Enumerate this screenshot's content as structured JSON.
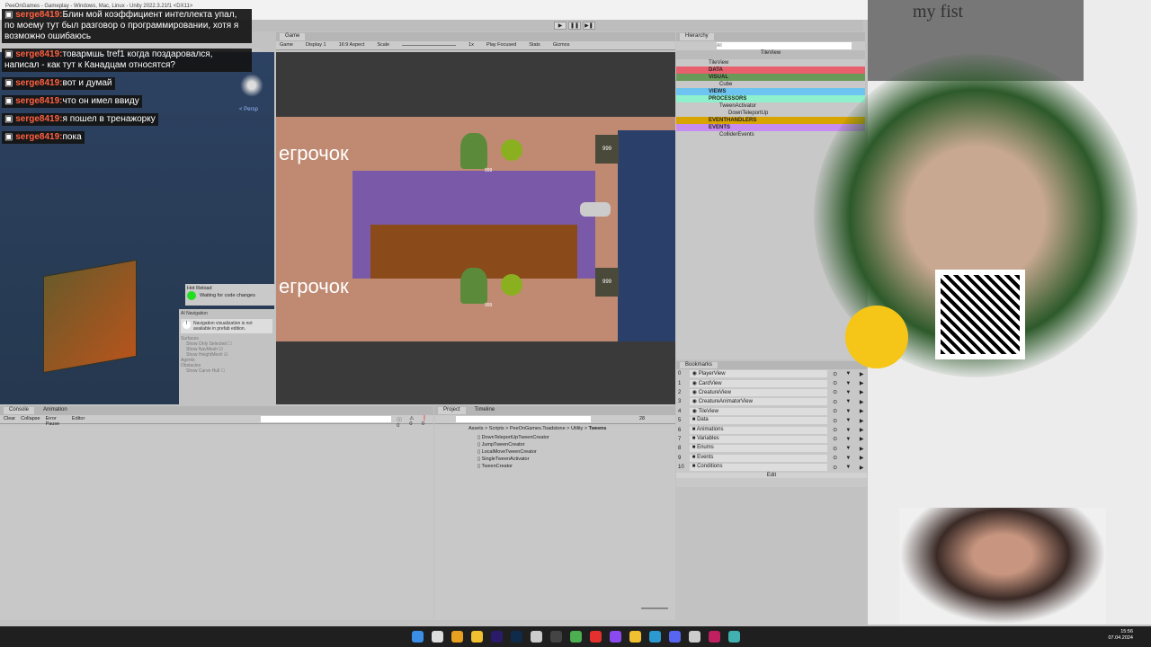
{
  "window": {
    "title": "PeeOnGames - Gameplay - Windows, Mac, Linux - Unity 2022.3.21f1 <DX11>"
  },
  "play_controls": [
    "▶",
    "❚❚",
    "▶❚"
  ],
  "chat": [
    {
      "user": "serge8419:",
      "text": "Блин мой коэффициент интеллекта упал, по моему тут был разговор о программировании, хотя я возможно ошибаюсь"
    },
    {
      "user": "serge8419:",
      "text": "товармшь tref1 когда поздаровался, написал - как тут к Канадцам относятся?"
    },
    {
      "user": "serge8419:",
      "text": "вот и думай"
    },
    {
      "user": "serge8419:",
      "text": "что он имел ввиду"
    },
    {
      "user": "serge8419:",
      "text": "я пошел в тренажорку"
    },
    {
      "user": "serge8419:",
      "text": "пока"
    }
  ],
  "scene": {
    "auto_save": "Auto Save",
    "persp": "< Persp",
    "hot_reload": {
      "title": "Hot Reload",
      "status": "Waiting for code changes",
      "status_color": "#22dd22"
    },
    "ai_nav": {
      "title": "AI Navigation",
      "warning": "Navigation visualization is not available in prefab edition.",
      "surfaces": "Surfaces",
      "items": [
        {
          "label": "Show Only Selected",
          "checked": false
        },
        {
          "label": "Show NavMesh",
          "checked": true
        },
        {
          "label": "Show HeightMesh",
          "checked": true
        }
      ],
      "agents": "Agents",
      "obstacles": "Obstacles",
      "obstacle_items": [
        {
          "label": "Show Carve Hull",
          "checked": false
        }
      ]
    }
  },
  "game": {
    "tab": "Game",
    "toolbar": {
      "mode": "Game",
      "display": "Display 1",
      "aspect": "16:9 Aspect",
      "scale_label": "Scale",
      "scale_value": "1x",
      "play_mode": "Play Focused",
      "stats": "Stats",
      "gizmos": "Gizmos"
    },
    "player_labels": [
      "егрочок",
      "егрочок"
    ],
    "counters": [
      "999",
      "999",
      "999",
      "999"
    ]
  },
  "hierarchy": {
    "tab": "Hierarchy",
    "search_placeholder": "All",
    "root": "TileView",
    "rows": [
      {
        "label": "TileView",
        "color": ""
      },
      {
        "label": "DATA",
        "color": "#e8606e"
      },
      {
        "label": "VISUAL",
        "color": "#6a9a5a"
      },
      {
        "label": "Cube",
        "color": ""
      },
      {
        "label": "VIEWS",
        "color": "#6ec4f0"
      },
      {
        "label": "PROCESSORS",
        "color": "#8ef0cc"
      },
      {
        "label": "TweenActivator",
        "color": ""
      },
      {
        "label": "DownTeleportUp",
        "color": ""
      },
      {
        "label": "EVENTHANDLERS",
        "color": "#d8a400"
      },
      {
        "label": "EVENTS",
        "color": "#c68cf0"
      },
      {
        "label": "ColliderEvents",
        "color": ""
      }
    ]
  },
  "bookmarks": {
    "tab": "Bookmarks",
    "items": [
      "PlayerView",
      "CardView",
      "CreatureView",
      "CreatureAnimatorView",
      "TileView",
      "Data",
      "Animations",
      "Variables",
      "Enums",
      "Events",
      "Conditions"
    ],
    "edit": "Edit"
  },
  "console": {
    "tabs": [
      "Console",
      "Animation"
    ],
    "buttons": [
      "Clear",
      "Collapse",
      "Error Pause",
      "Editor"
    ],
    "counts": [
      "0",
      "0",
      "0"
    ]
  },
  "project": {
    "tabs": [
      "Project",
      "Timeline"
    ],
    "hidden_count": "28",
    "breadcrumb": [
      "Assets",
      "Scripts",
      "PeeOnGames.Toadstone",
      "Utility",
      "Tweens"
    ],
    "files": [
      "DownTeleportUpTweenCreator",
      "JumpTweenCreator",
      "LocalMoveTweenCreator",
      "SingleTweenActivator",
      "TweenCreator"
    ]
  },
  "overlay": {
    "tombstone_text": "my fist"
  },
  "taskbar": {
    "time": "15:56",
    "date": "07.04.2024",
    "icons": [
      "windows-start",
      "unity-hub",
      "sublime",
      "explorer",
      "premiere",
      "photoshop",
      "unity",
      "obs",
      "chrome",
      "youtube",
      "github-desktop",
      "yandex",
      "edge",
      "discord",
      "unity-editor",
      "rider",
      "misc"
    ]
  }
}
